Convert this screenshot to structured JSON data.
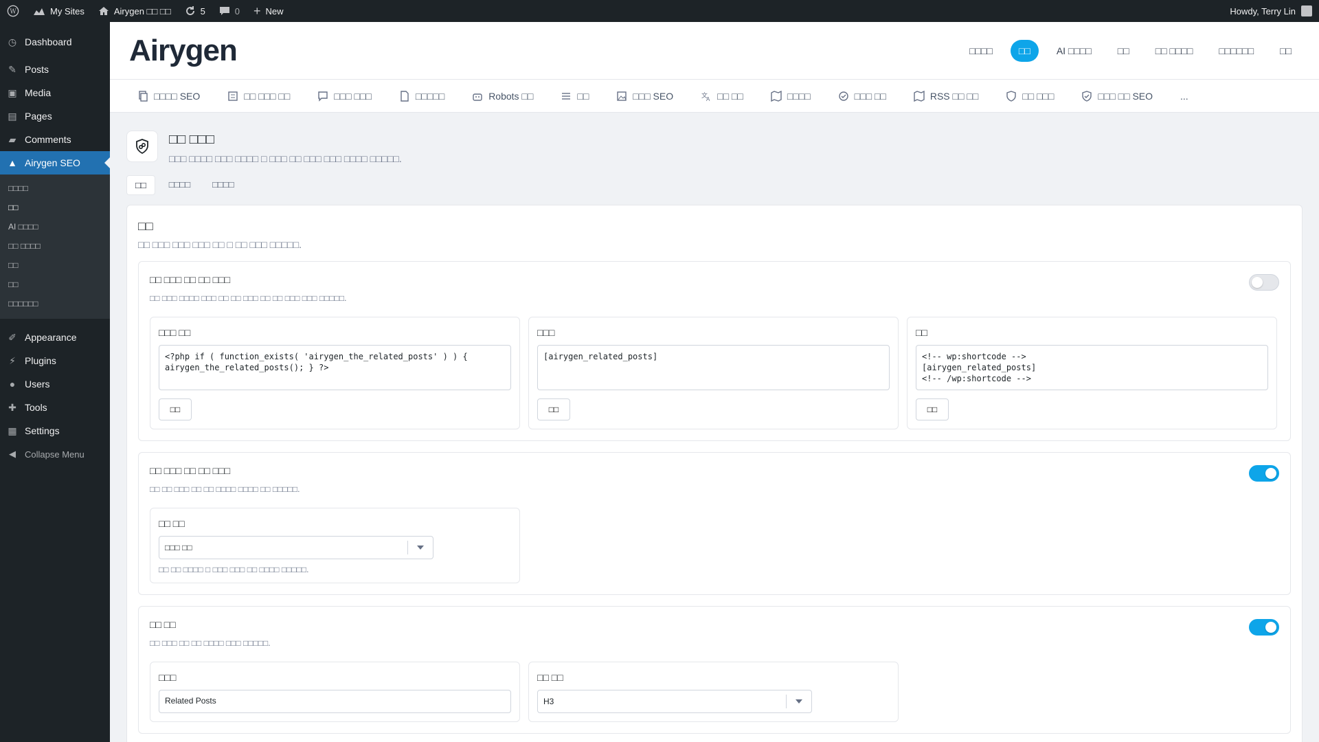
{
  "adminbar": {
    "my_sites": "My Sites",
    "site_name": "Airygen □□ □□",
    "updates": "5",
    "comments": "0",
    "new": "New",
    "howdy": "Howdy, Terry Lin"
  },
  "sidebar": {
    "items": [
      "Dashboard",
      "Posts",
      "Media",
      "Pages",
      "Comments",
      "Airygen SEO"
    ],
    "sub_items": [
      "□□□□",
      "□□",
      "AI □□□□",
      "□□ □□□□",
      "□□",
      "□□",
      "□□□□□□"
    ],
    "bottom_items": [
      "Appearance",
      "Plugins",
      "Users",
      "Tools",
      "Settings",
      "Collapse Menu"
    ]
  },
  "header": {
    "logo": "Airygen",
    "nav": [
      "□□□□",
      "□□",
      "AI □□□□",
      "□□",
      "□□ □□□□",
      "□□□□□□",
      "□□"
    ]
  },
  "subnav": [
    "□□□□ SEO",
    "□□ □□□ □□",
    "□□□ □□□",
    "□□□□□",
    "Robots □□",
    "□□",
    "□□□ SEO",
    "□□ □□",
    "□□□□",
    "□□□ □□",
    "RSS □□ □□",
    "□□ □□□",
    "□□□ □□ SEO",
    "..."
  ],
  "page": {
    "title": "□□ □□□",
    "desc": "□□□ □□□□ □□□ □□□□ □ □□□ □□ □□□ □□□ □□□□ □□□□□.",
    "tabs": [
      "□□",
      "□□□□",
      "□□□□"
    ]
  },
  "card": {
    "title": "□□",
    "desc": "□□ □□□ □□□ □□□ □□ □ □□ □□□ □□□□□."
  },
  "section1": {
    "title": "□□ □□□ □□ □□ □□□",
    "desc": "□□ □□□ □□□□ □□□ □□ □□ □□□ □□ □□ □□□ □□□ □□□□□.",
    "boxes": [
      {
        "label": "□□□ □□",
        "code": "<?php if ( function_exists( 'airygen_the_related_posts' ) ) {\nairygen_the_related_posts(); } ?>",
        "button": "□□"
      },
      {
        "label": "□□□",
        "code": "[airygen_related_posts]",
        "button": "□□"
      },
      {
        "label": "□□",
        "code": "<!-- wp:shortcode -->\n[airygen_related_posts]\n<!-- /wp:shortcode -->",
        "button": "□□"
      }
    ]
  },
  "section2": {
    "title": "□□ □□□ □□ □□ □□□",
    "desc": "□□ □□ □□□ □□ □□ □□□□ □□□□ □□ □□□□□.",
    "field_label": "□□ □□",
    "select_value": "□□□ □□",
    "hint": "□□ □□ □□□□ □ □□□ □□□ □□ □□□□ □□□□□."
  },
  "section3": {
    "title": "□□ □□",
    "desc": "□□ □□□ □□ □□ □□□□ □□□ □□□□□.",
    "field1_label": "□□□",
    "field1_value": "Related Posts",
    "field2_label": "□□ □□",
    "field2_value": "H3"
  }
}
